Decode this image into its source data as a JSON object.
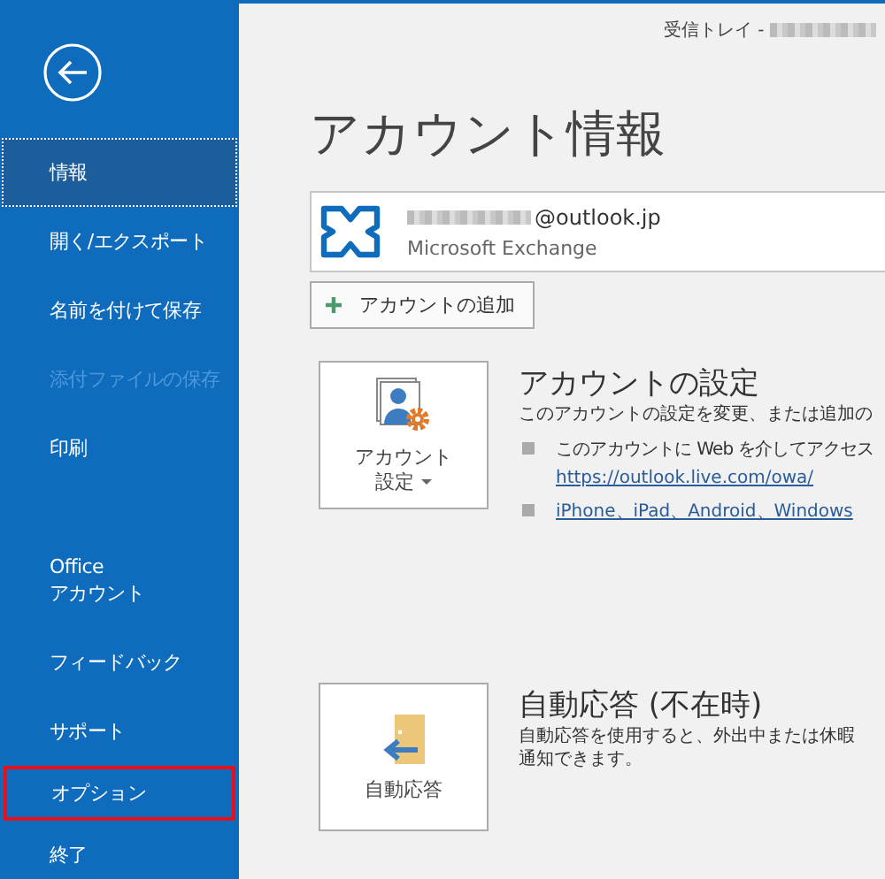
{
  "window": {
    "title": "受信トレイ - "
  },
  "sidebar": {
    "items": [
      {
        "kind": "item",
        "label": "情報",
        "selected": true,
        "disabled": false,
        "highlighted": false
      },
      {
        "kind": "item",
        "label": "開く/エクスポート",
        "selected": false,
        "disabled": false,
        "highlighted": false
      },
      {
        "kind": "item",
        "label": "名前を付けて保存",
        "selected": false,
        "disabled": false,
        "highlighted": false
      },
      {
        "kind": "item",
        "label": "添付ファイルの保存",
        "selected": false,
        "disabled": true,
        "highlighted": false
      },
      {
        "kind": "item",
        "label": "印刷",
        "selected": false,
        "disabled": false,
        "highlighted": false
      },
      {
        "kind": "separator"
      },
      {
        "kind": "item",
        "label": "Office\nアカウント",
        "selected": false,
        "disabled": false,
        "highlighted": false
      },
      {
        "kind": "item",
        "label": "フィードバック",
        "selected": false,
        "disabled": false,
        "highlighted": false
      },
      {
        "kind": "item",
        "label": "サポート",
        "selected": false,
        "disabled": false,
        "highlighted": false
      },
      {
        "kind": "item",
        "label": "オプション",
        "selected": false,
        "disabled": false,
        "highlighted": true
      },
      {
        "kind": "item",
        "label": "終了",
        "selected": false,
        "disabled": false,
        "highlighted": false
      }
    ]
  },
  "main": {
    "heading": "アカウント情報",
    "account": {
      "address": "@outlook.jp",
      "type": "Microsoft Exchange"
    },
    "add_account_button": "アカウントの追加",
    "sections": [
      {
        "kind": "account-settings",
        "tile_label": [
          "アカウント",
          "設定"
        ],
        "dropdown": true,
        "heading": "アカウントの設定",
        "description": [
          "このアカウントの設定を変更、または追加の"
        ],
        "bullets": [
          {
            "text": "このアカウントに Web を介してアクセス",
            "link": "https://outlook.live.com/owa/"
          },
          {
            "link": "iPhone、iPad、Android、Windows"
          }
        ]
      },
      {
        "kind": "auto-reply",
        "tile_label": [
          "自動応答"
        ],
        "dropdown": false,
        "heading": "自動応答 (不在時)",
        "description": [
          "自動応答を使用すると、外出中または休暇",
          "通知できます。"
        ]
      }
    ]
  }
}
